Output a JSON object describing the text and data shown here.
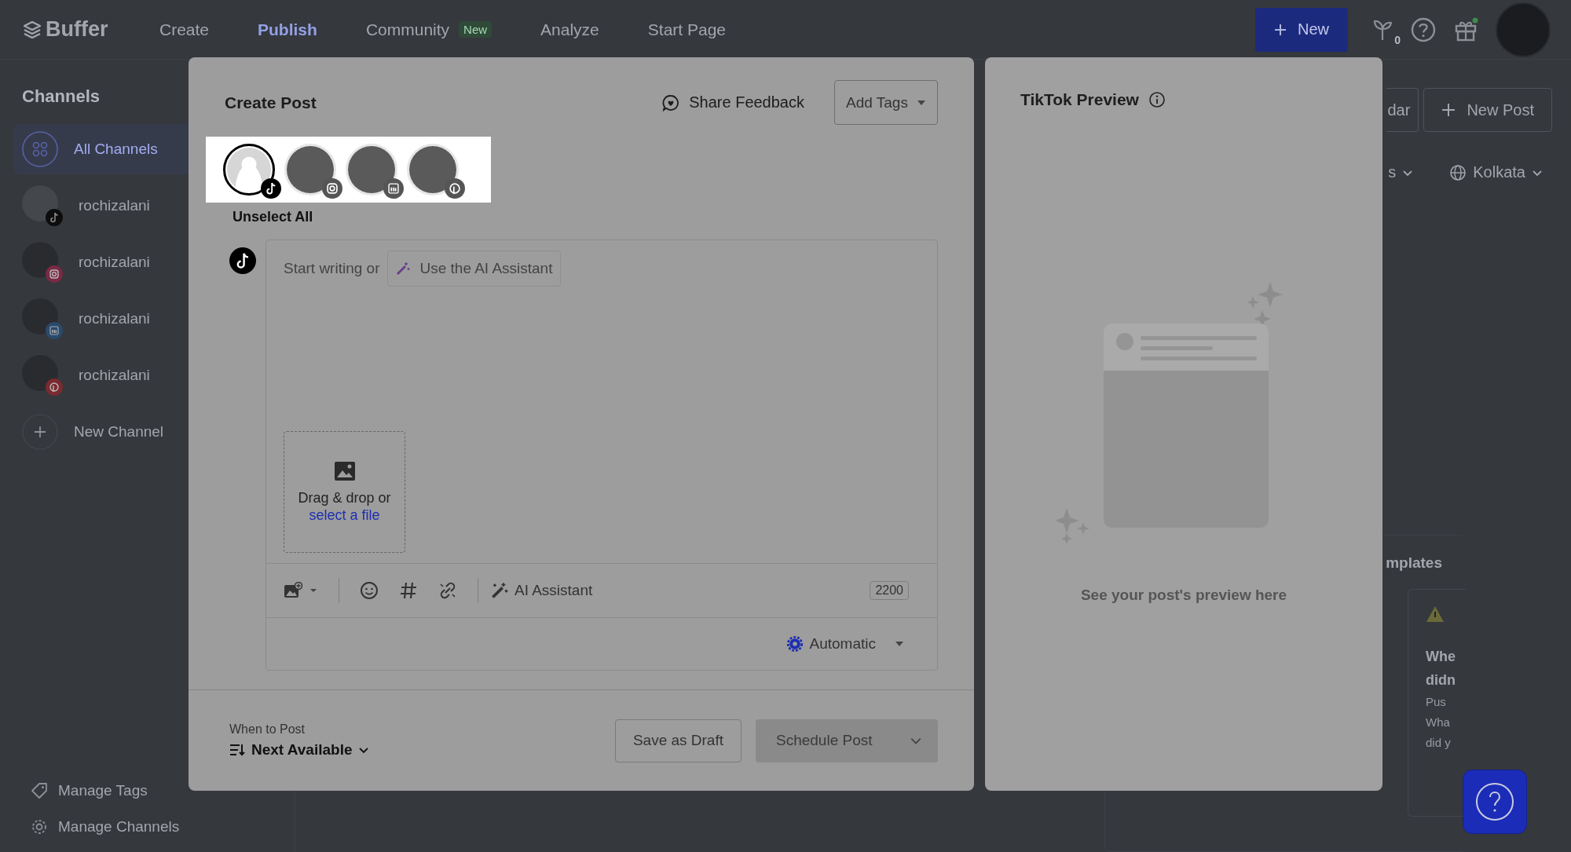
{
  "nav": {
    "logo": "Buffer",
    "items": [
      {
        "label": "Create",
        "selected": false
      },
      {
        "label": "Publish",
        "selected": true
      },
      {
        "label": "Community",
        "selected": false,
        "badge": "New"
      },
      {
        "label": "Analyze",
        "selected": false
      },
      {
        "label": "Start Page",
        "selected": false
      }
    ],
    "new_button": "New",
    "plant_count": "0"
  },
  "sidebar": {
    "title": "Channels",
    "items": [
      {
        "label": "All Channels",
        "kind": "all",
        "selected": true
      },
      {
        "label": "rochizalani",
        "kind": "tiktok",
        "avatar": {
          "kind": "silhouette"
        },
        "selected": false
      },
      {
        "label": "rochizalani",
        "kind": "instagram",
        "avatar": {
          "kind": "photo"
        },
        "selected": false
      },
      {
        "label": "rochizalani",
        "kind": "linkedin",
        "avatar": {
          "kind": "photo"
        },
        "selected": false
      },
      {
        "label": "rochizalani",
        "kind": "pinterest",
        "avatar": {
          "kind": "photo"
        },
        "selected": false
      }
    ],
    "new_channel": "New Channel",
    "footer": [
      {
        "label": "Manage Tags",
        "kind": "tag"
      },
      {
        "label": "Manage Channels",
        "kind": "gear"
      }
    ]
  },
  "background": {
    "calendar_button": "dar",
    "new_post": "New Post",
    "filter": "s",
    "timezone": "Kolkata",
    "templates_title": "mplates",
    "card_title": [
      "Whe",
      "didn"
    ],
    "card_body": [
      "Pus",
      "Wha",
      "did y"
    ]
  },
  "composer": {
    "title": "Create Post",
    "feedback": "Share Feedback",
    "tags": "Add Tags",
    "channels": [
      {
        "kind": "tiktok",
        "avatar": {
          "kind": "silhouette"
        },
        "selected": true
      },
      {
        "kind": "instagram",
        "avatar": {
          "kind": "photo"
        },
        "selected": false
      },
      {
        "kind": "linkedin",
        "avatar": {
          "kind": "photo"
        },
        "selected": false
      },
      {
        "kind": "pinterest",
        "avatar": {
          "kind": "photo"
        },
        "selected": false
      }
    ],
    "unselect": "Unselect All",
    "placeholder": "Start writing or",
    "ai_chip": "Use the AI Assistant",
    "drop_text": "Drag & drop or",
    "drop_link": "select a file",
    "toolbar_ai": "AI Assistant",
    "char_count": "2200",
    "mode": "Automatic",
    "when_label": "When to Post",
    "when_value": "Next Available",
    "draft": "Save as Draft",
    "schedule": "Schedule Post"
  },
  "preview": {
    "title": "TikTok Preview",
    "empty": "See your post's preview here"
  }
}
